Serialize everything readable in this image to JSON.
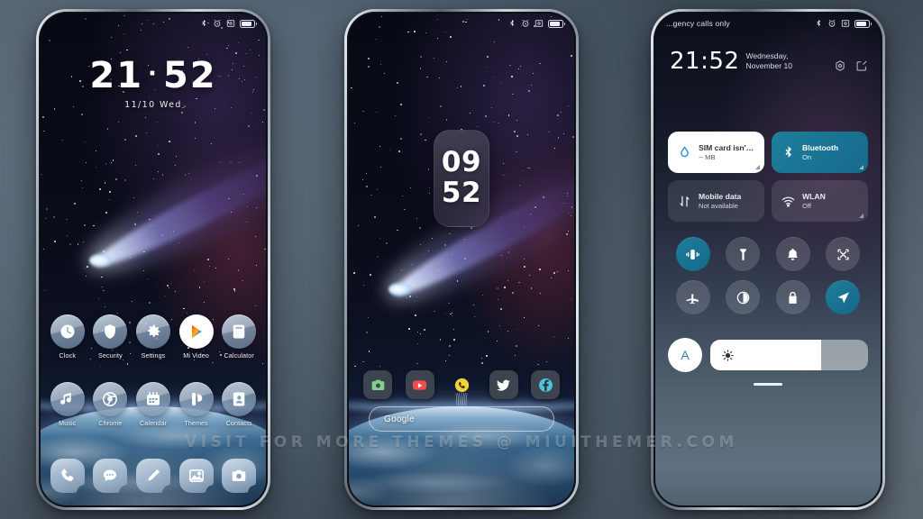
{
  "watermark": "VISIT FOR MORE THEMES @ MIUITHEMER.COM",
  "phone1": {
    "status": {
      "carrier": "",
      "icons": [
        "bluetooth-icon",
        "alarm-icon",
        "screenshot-icon",
        "battery-icon"
      ]
    },
    "clock": {
      "hours": "21",
      "separator": "·",
      "minutes": "52",
      "date": "11/10  Wed"
    },
    "apps_row1": [
      {
        "label": "Clock",
        "icon": "clock-icon"
      },
      {
        "label": "Security",
        "icon": "shield-icon"
      },
      {
        "label": "Settings",
        "icon": "gear-icon"
      },
      {
        "label": "Mi Video",
        "icon": "mi-video-icon"
      },
      {
        "label": "Calculator",
        "icon": "calculator-icon"
      }
    ],
    "apps_row2": [
      {
        "label": "Music",
        "icon": "music-note-icon"
      },
      {
        "label": "Chrome",
        "icon": "chrome-icon"
      },
      {
        "label": "Calendar",
        "icon": "calendar-icon"
      },
      {
        "label": "Themes",
        "icon": "themes-icon"
      },
      {
        "label": "Contacts",
        "icon": "contacts-icon"
      }
    ],
    "dock": [
      {
        "label": "Phone",
        "icon": "phone-icon"
      },
      {
        "label": "Messages",
        "icon": "message-icon"
      },
      {
        "label": "Notes",
        "icon": "pencil-icon"
      },
      {
        "label": "Gallery",
        "icon": "gallery-icon"
      },
      {
        "label": "Camera",
        "icon": "camera-icon"
      }
    ]
  },
  "phone2": {
    "status": {
      "icons": [
        "bluetooth-icon",
        "alarm-icon",
        "screenshot-icon",
        "battery-icon"
      ]
    },
    "widget": {
      "hours": "09",
      "minutes": "52"
    },
    "apps": [
      {
        "label": "Camera",
        "icon": "camera-icon",
        "color": "#3c4450",
        "accent": "#7fd18b"
      },
      {
        "label": "YouTube",
        "icon": "youtube-icon",
        "color": "#3c4450",
        "accent": "#ee4d4d"
      },
      {
        "label": "WhatsApp",
        "icon": "whatsapp-icon",
        "color": "transparent",
        "accent": "#f0d33a"
      },
      {
        "label": "Twitter",
        "icon": "twitter-icon",
        "color": "#3c4450",
        "accent": "#ffffff"
      },
      {
        "label": "Facebook",
        "icon": "facebook-icon",
        "color": "#3c4450",
        "accent": "#4fc3d9"
      }
    ],
    "search": {
      "placeholder": "Google",
      "icon": "google-search-bar"
    }
  },
  "phone3": {
    "status": {
      "carrier": "...gency calls only",
      "icons": [
        "bluetooth-icon",
        "alarm-icon",
        "screenshot-icon",
        "battery-icon"
      ]
    },
    "header": {
      "time": "21:52",
      "date": "Wednesday, November 10",
      "actions": [
        {
          "name": "settings-icon"
        },
        {
          "name": "edit-icon"
        }
      ]
    },
    "tiles": [
      {
        "title": "SIM card isn't inserted",
        "subtitle": "-- MB",
        "icon": "data-usage-icon",
        "state": "off",
        "style": "data"
      },
      {
        "title": "Bluetooth",
        "subtitle": "On",
        "icon": "bluetooth-icon",
        "state": "on",
        "style": "bt"
      },
      {
        "title": "Mobile data",
        "subtitle": "Not available",
        "icon": "mobile-data-icon",
        "state": "off",
        "style": "mob"
      },
      {
        "title": "WLAN",
        "subtitle": "Off",
        "icon": "wifi-icon",
        "state": "off",
        "style": "wlan"
      }
    ],
    "toggles": [
      {
        "name": "vibrate-icon",
        "label": "Vibrate",
        "state": "on"
      },
      {
        "name": "flashlight-icon",
        "label": "Flashlight",
        "state": "off"
      },
      {
        "name": "bell-icon",
        "label": "Ringer",
        "state": "off"
      },
      {
        "name": "screenshot-icon",
        "label": "Screenshot",
        "state": "off"
      },
      {
        "name": "airplane-icon",
        "label": "Airplane mode",
        "state": "off"
      },
      {
        "name": "dark-mode-icon",
        "label": "Dark mode",
        "state": "off"
      },
      {
        "name": "lock-icon",
        "label": "Lock",
        "state": "off"
      },
      {
        "name": "location-icon",
        "label": "Location",
        "state": "on"
      }
    ],
    "brightness": {
      "auto_label": "A",
      "icon": "brightness-icon",
      "value": 70
    }
  }
}
